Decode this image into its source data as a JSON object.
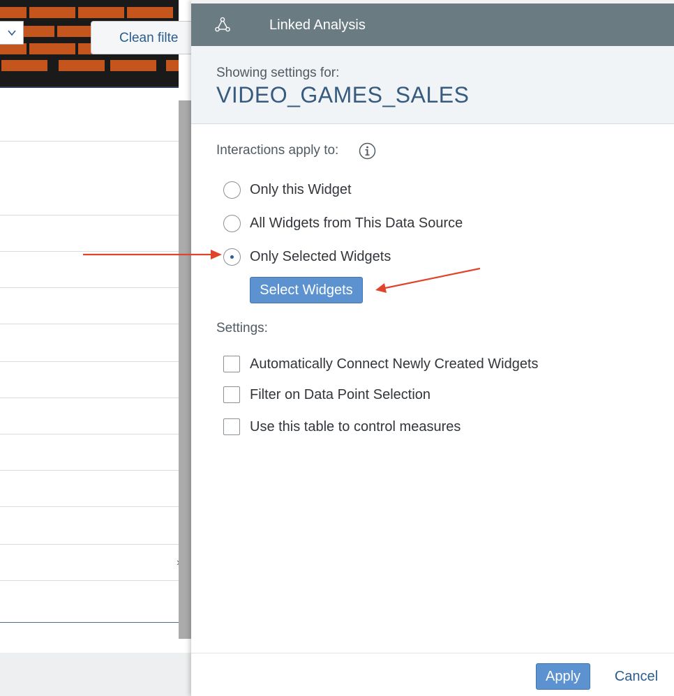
{
  "background": {
    "clean_filter_label": "Clean filte"
  },
  "panel": {
    "header_title": "Linked Analysis",
    "header_icon": "linked-analysis-icon",
    "source_caption": "Showing settings for:",
    "source_name": "VIDEO_GAMES_SALES",
    "interactions_label": "Interactions apply to:",
    "interaction_options": [
      {
        "label": "Only this Widget",
        "checked": false
      },
      {
        "label": "All Widgets from This Data Source",
        "checked": false
      },
      {
        "label": "Only Selected Widgets",
        "checked": true
      }
    ],
    "select_widgets_label": "Select Widgets",
    "settings_label": "Settings:",
    "settings_options": [
      {
        "label": "Automatically Connect Newly Created Widgets",
        "checked": false
      },
      {
        "label": "Filter on Data Point Selection",
        "checked": false
      },
      {
        "label": "Use this table to control measures",
        "checked": false
      }
    ],
    "apply_label": "Apply",
    "cancel_label": "Cancel"
  },
  "colors": {
    "header_bg": "#6b7b82",
    "primary_button": "#5b92cf",
    "source_name": "#375a7f",
    "annotation_arrow": "#e0452b"
  }
}
